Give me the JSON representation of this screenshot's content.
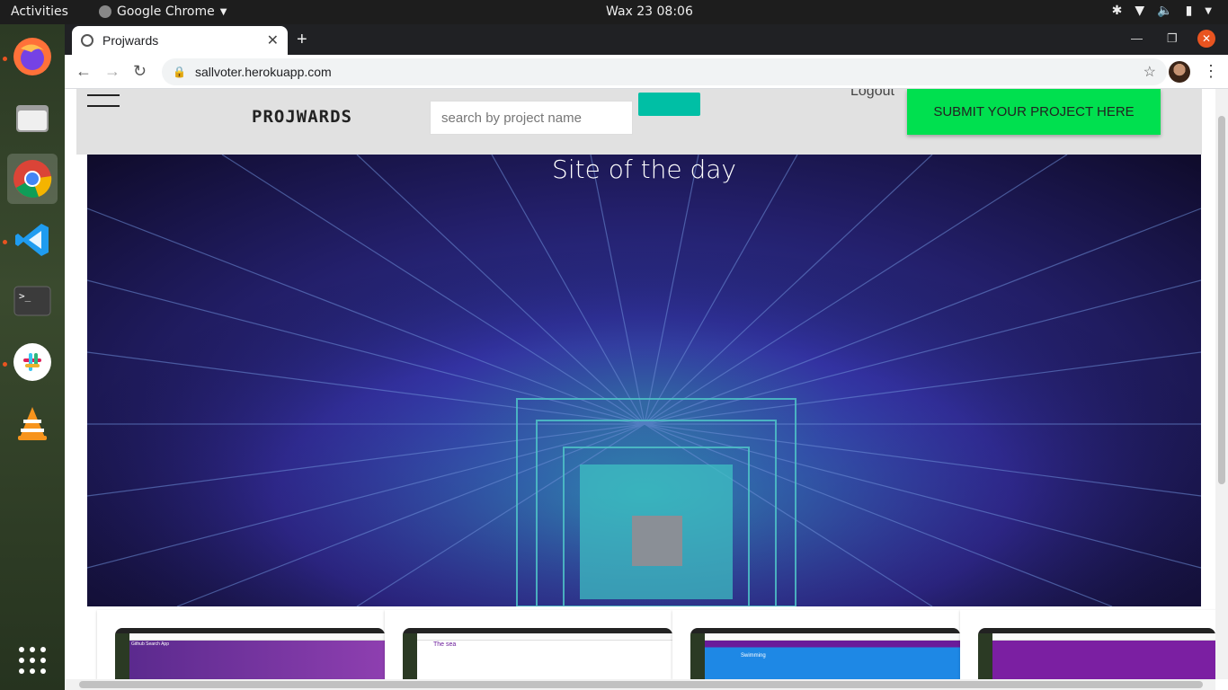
{
  "topbar": {
    "activities": "Activities",
    "app_menu": "Google Chrome",
    "clock": "Wax 23  08:06"
  },
  "dock": {
    "items": [
      "firefox-icon",
      "files-icon",
      "chrome-icon",
      "vscode-icon",
      "terminal-icon",
      "slack-icon",
      "vlc-icon",
      "app-grid-icon"
    ]
  },
  "browser": {
    "tab_title": "Projwards",
    "url": "sallvoter.herokuapp.com"
  },
  "site": {
    "brand": "PROJWARDS",
    "search_placeholder": "search by project name",
    "logout": "Logout",
    "submit_label": "SUBMIT YOUR PROJECT HERE",
    "hero_title": "Site of the day",
    "colors": {
      "accent_teal": "#00bfa5",
      "submit_green": "#00e04f"
    },
    "cards": [
      {
        "snippet": "Github Search App"
      },
      {
        "snippet": "The sea"
      },
      {
        "snippet": "Swimming"
      },
      {
        "snippet": ""
      }
    ]
  }
}
